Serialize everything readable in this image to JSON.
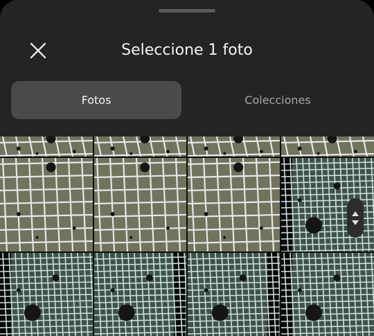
{
  "sheet": {
    "title": "Seleccione 1 foto",
    "close_icon": "close-icon"
  },
  "tabs": [
    {
      "label": "Fotos",
      "selected": true
    },
    {
      "label": "Colecciones",
      "selected": false
    }
  ],
  "gallery": {
    "thumbnails": [
      {
        "kind": "grid-photo"
      },
      {
        "kind": "grid-photo"
      },
      {
        "kind": "grid-photo"
      },
      {
        "kind": "grid-photo"
      },
      {
        "kind": "grid-photo"
      },
      {
        "kind": "grid-photo"
      },
      {
        "kind": "grid-photo"
      },
      {
        "kind": "grid-photo"
      },
      {
        "kind": "grid-photo"
      },
      {
        "kind": "grid-photo"
      },
      {
        "kind": "grid-photo"
      },
      {
        "kind": "grid-photo"
      }
    ],
    "fast_scroll_icon": "updown-scroll-icon"
  },
  "colors": {
    "sheet_background": "#242424",
    "tab_active_background": "#4a4a4a",
    "tab_inactive_text": "#a7a7a7",
    "photo_olive": "#71735c",
    "photo_teal": "#3e5449"
  }
}
